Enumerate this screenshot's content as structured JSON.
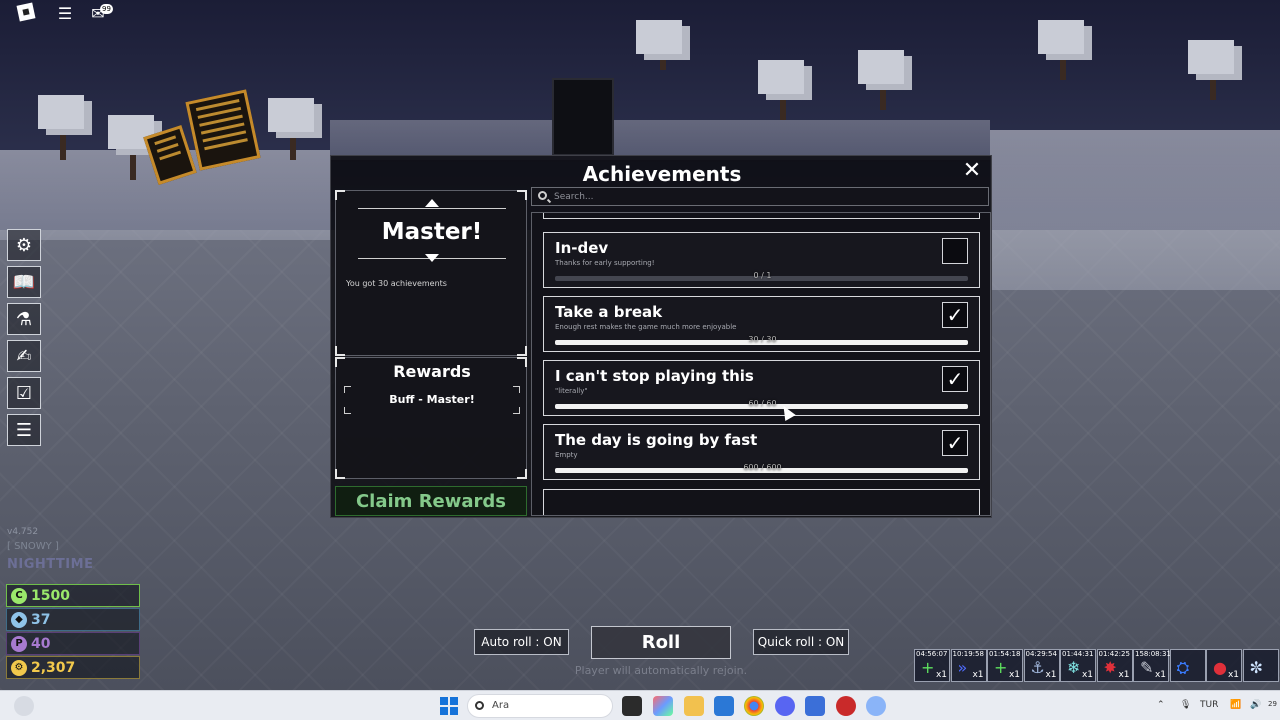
{
  "window": {
    "title": "Achievements",
    "close_icon": "close-icon"
  },
  "topbar": {
    "chat_badge": "99"
  },
  "selected": {
    "name": "Master!",
    "description": "You got 30 achievements",
    "rewards_title": "Rewards",
    "rewards": [
      "Buff - Master!"
    ],
    "claim_label": "Claim Rewards"
  },
  "search": {
    "placeholder": "Search..."
  },
  "achievements": [
    {
      "name": "In-dev",
      "description": "Thanks for early supporting!",
      "progress_text": "0 / 1",
      "progress": 0.0,
      "completed": false
    },
    {
      "name": "Take a break",
      "description": "Enough rest makes the game much more enjoyable",
      "progress_text": "30 / 30",
      "progress": 1.0,
      "completed": true
    },
    {
      "name": "I can't stop playing this",
      "description": "\"literally\"",
      "progress_text": "60 / 60",
      "progress": 1.0,
      "completed": true
    },
    {
      "name": "The day is going by fast",
      "description": "Empty",
      "progress_text": "600 / 600",
      "progress": 1.0,
      "completed": true
    }
  ],
  "hud": {
    "version": "v4.752",
    "weather": "[ SNOWY ]",
    "daytime": "NIGHTTIME",
    "stats": [
      {
        "value": "1500",
        "color": "#9be86b",
        "border": "#6fbf4a",
        "icon": "coin-icon"
      },
      {
        "value": "37",
        "color": "#8fc3e8",
        "border": "#3f6c88",
        "icon": "gem-icon"
      },
      {
        "value": "40",
        "color": "#a77ad0",
        "border": "#5a3f77",
        "icon": "orb-icon"
      },
      {
        "value": "2,307",
        "color": "#f2c94c",
        "border": "#8a7a3a",
        "icon": "gear-coin-icon"
      }
    ]
  },
  "controls": {
    "auto_roll": "Auto roll : ON",
    "roll": "Roll",
    "quick_roll": "Quick roll : ON",
    "rejoin_notice": "Player will automatically rejoin."
  },
  "buffs": [
    {
      "time": "04:56:07",
      "count": "x1",
      "color": "#5ee05e",
      "glyph": "+"
    },
    {
      "time": "10:19:58",
      "count": "x1",
      "color": "#4f6cff",
      "glyph": "»"
    },
    {
      "time": "01:54:18",
      "count": "x1",
      "color": "#5ee05e",
      "glyph": "+"
    },
    {
      "time": "04:29:54",
      "count": "x1",
      "color": "#9fb4d8",
      "glyph": "⚓"
    },
    {
      "time": "01:44:31",
      "count": "x1",
      "color": "#7fe3e3",
      "glyph": "❄"
    },
    {
      "time": "01:42:25",
      "count": "x1",
      "color": "#e0303a",
      "glyph": "✸"
    },
    {
      "time": "158:08:31",
      "count": "x1",
      "color": "#c8ccd6",
      "glyph": "✎"
    },
    {
      "time": "",
      "count": "",
      "color": "#3a7cff",
      "glyph": "⛭"
    },
    {
      "time": "",
      "count": "x1",
      "color": "#e0303a",
      "glyph": "●"
    },
    {
      "time": "",
      "count": "",
      "color": "#cfe4ff",
      "glyph": "✼"
    }
  ],
  "taskbar": {
    "search_label": "Ara",
    "language": "TUR",
    "date_hint": "29"
  },
  "colors": {
    "panel_bg": "#0c0c10",
    "claim_green": "#84c98a",
    "accent_white": "#ffffff"
  }
}
